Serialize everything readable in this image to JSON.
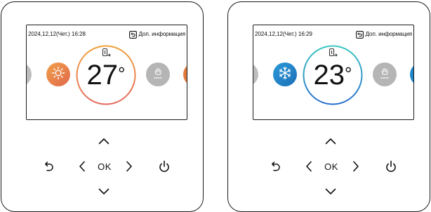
{
  "panels": [
    {
      "datetime": "2024,12,12(Чет.)  16:28",
      "info_label": "Доп. информация",
      "temperature": "27",
      "temperature_unit": "°",
      "mode": "heat",
      "mode_icon": "sun-icon",
      "ring_gradient": [
        "#f0a23c",
        "#e26a5e"
      ],
      "mode_color": "#e4853d",
      "ok_label": "OK"
    },
    {
      "datetime": "2024,12,12(Чет.)  16:29",
      "info_label": "Доп. информация",
      "temperature": "23",
      "temperature_unit": "°",
      "mode": "cool",
      "mode_icon": "snowflake-icon",
      "ring_gradient": [
        "#3ac7c0",
        "#2a6fd0"
      ],
      "mode_color": "#1f7fc6",
      "ok_label": "OK"
    }
  ],
  "colors": {
    "inactive_grey": "#b0b0b0",
    "heat_side": "#e07a3a",
    "cool_side": "#1f86c8"
  }
}
